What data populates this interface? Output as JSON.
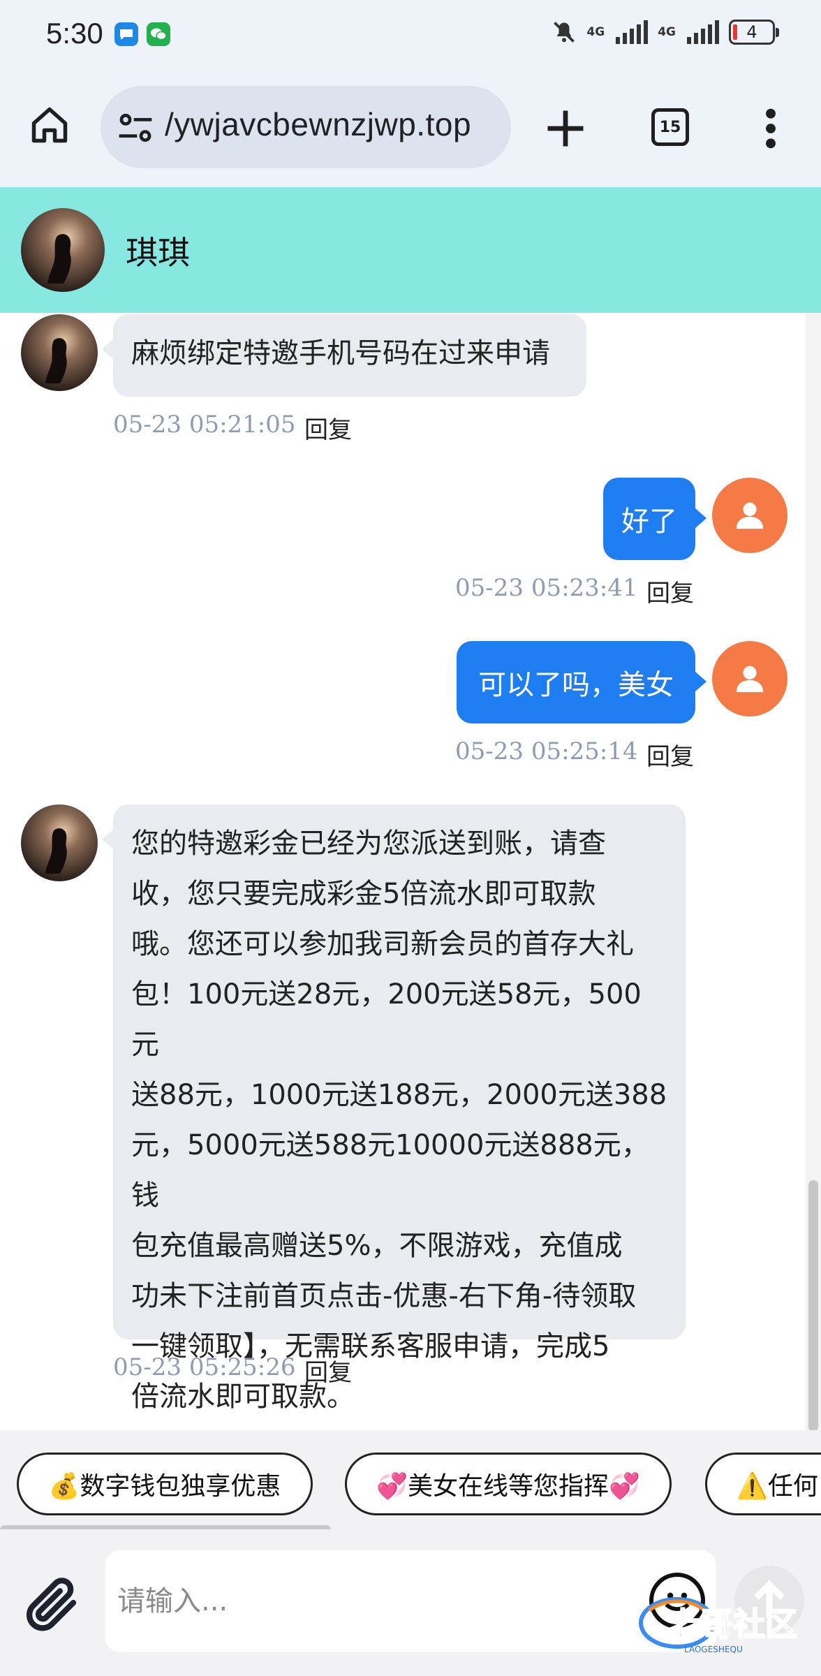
{
  "status_bar": {
    "time": "5:30",
    "net1": "4G",
    "net2": "4G",
    "battery": "4"
  },
  "browser": {
    "url": "/ywjavcbewnzjwp.top",
    "tab_count": "15"
  },
  "chat_header": {
    "contact_name": "琪琪"
  },
  "messages": [
    {
      "side": "left",
      "text": "麻烦绑定特邀手机号码在过来申请",
      "time": "05-23 05:21:05",
      "reply": "回复"
    },
    {
      "side": "right",
      "text": "好了",
      "time": "05-23 05:23:41",
      "reply": "回复"
    },
    {
      "side": "right",
      "text": "可以了吗，美女",
      "time": "05-23 05:25:14",
      "reply": "回复"
    },
    {
      "side": "left",
      "lines": [
        "您的特邀彩金已经为您派送到账，请查",
        "收，您只要完成彩金5倍流水即可取款",
        "哦。您还可以参加我司新会员的首存大礼",
        "包！100元送28元，200元送58元，500元",
        "送88元，1000元送188元，2000元送388",
        "元，5000元送588元10000元送888元，钱",
        "包充值最高赠送5%，不限游戏，充值成",
        "功未下注前首页点击-优惠-右下角-待领取",
        "一键领取】，无需联系客服申请，完成5",
        "倍流水即可取款。"
      ],
      "time": "05-23 05:25:26",
      "reply": "回复"
    }
  ],
  "quick_replies": [
    "💰数字钱包独享优惠",
    "💞美女在线等您指挥💞",
    "⚠️任何"
  ],
  "input": {
    "placeholder": "请输入..."
  },
  "watermark": {
    "text": "老哥社区",
    "sub": "LAOGESHEQU"
  },
  "colors": {
    "header_bg": "#86e8e1",
    "user_bubble": "#1e7df0",
    "user_avatar": "#f57a45",
    "agent_bubble": "#e9ebf0"
  }
}
